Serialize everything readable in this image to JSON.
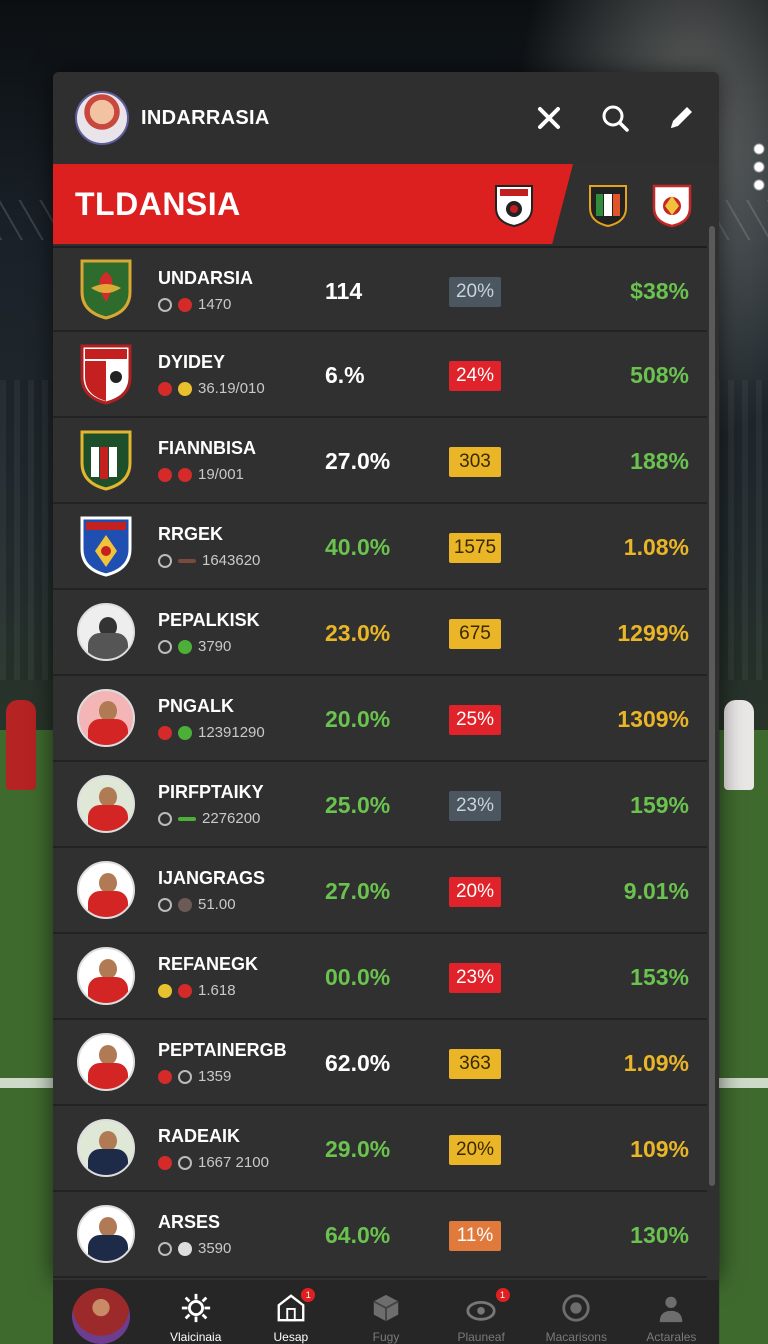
{
  "header": {
    "title": "INDARRASIA",
    "banner_title": "TLDANSIA"
  },
  "icons": {
    "close": "close-icon",
    "search": "search-icon",
    "edit": "pencil-icon"
  },
  "colors": {
    "banner": "#dc1f1f",
    "panel": "#303030",
    "green": "#6ac24f",
    "yellow": "#eab526",
    "red": "#e0232a",
    "slate": "#4b5660",
    "orange": "#e07a3c"
  },
  "rows": [
    {
      "name": "UNDARSIA",
      "sub": "1470",
      "value": "114",
      "badge": "20%",
      "pct": "$38%",
      "value_color": "white",
      "badge_color": "slate",
      "pct_color": "green"
    },
    {
      "name": "DYIDEY",
      "sub": "36.19/010",
      "value": "6.%",
      "badge": "24%",
      "pct": "508%",
      "value_color": "white",
      "badge_color": "red",
      "pct_color": "green"
    },
    {
      "name": "FIANNBISA",
      "sub": "19/001",
      "value": "27.0%",
      "badge": "303",
      "pct": "188%",
      "value_color": "white",
      "badge_color": "yellow",
      "pct_color": "green"
    },
    {
      "name": "RRGEK",
      "sub": "1643620",
      "value": "40.0%",
      "badge": "1575",
      "pct": "1.08%",
      "value_color": "green",
      "badge_color": "yellow",
      "pct_color": "yellow"
    },
    {
      "name": "PEPALKISK",
      "sub": "3790",
      "value": "23.0%",
      "badge": "675",
      "pct": "1299%",
      "value_color": "yellow",
      "badge_color": "yellow",
      "pct_color": "yellow"
    },
    {
      "name": "PNGALK",
      "sub": "12391290",
      "value": "20.0%",
      "badge": "25%",
      "pct": "1309%",
      "value_color": "green",
      "badge_color": "red",
      "pct_color": "yellow"
    },
    {
      "name": "PIRFPTAIKY",
      "sub": "2276200",
      "value": "25.0%",
      "badge": "23%",
      "pct": "159%",
      "value_color": "green",
      "badge_color": "slate",
      "pct_color": "green"
    },
    {
      "name": "IJANGRAGS",
      "sub": "51.00",
      "value": "27.0%",
      "badge": "20%",
      "pct": "9.01%",
      "value_color": "green",
      "badge_color": "red",
      "pct_color": "green"
    },
    {
      "name": "REFANEGK",
      "sub": "1.618",
      "value": "00.0%",
      "badge": "23%",
      "pct": "153%",
      "value_color": "green",
      "badge_color": "red",
      "pct_color": "green"
    },
    {
      "name": "PEPTAINERGB",
      "sub": "1359",
      "value": "62.0%",
      "badge": "363",
      "pct": "1.09%",
      "value_color": "white",
      "badge_color": "yellow",
      "pct_color": "yellow"
    },
    {
      "name": "RADEAIK",
      "sub": "1667 2100",
      "value": "29.0%",
      "badge": "20%",
      "pct": "109%",
      "value_color": "green",
      "badge_color": "yellow",
      "pct_color": "yellow"
    },
    {
      "name": "ARSES",
      "sub": "3590",
      "value": "64.0%",
      "badge": "11%",
      "pct": "130%",
      "value_color": "green",
      "badge_color": "orange",
      "pct_color": "green"
    }
  ],
  "nav": [
    {
      "label": "",
      "icon": "profile-avatar"
    },
    {
      "label": "Vlaicinaia",
      "icon": "gear-icon"
    },
    {
      "label": "Uesap",
      "icon": "home-icon",
      "badge": "1"
    },
    {
      "label": "Fugy",
      "icon": "cube-icon"
    },
    {
      "label": "Plauneaf",
      "icon": "ball-icon",
      "badge": "1"
    },
    {
      "label": "Macarisons",
      "icon": "badge-icon"
    },
    {
      "label": "Actarales",
      "icon": "person-icon"
    }
  ]
}
